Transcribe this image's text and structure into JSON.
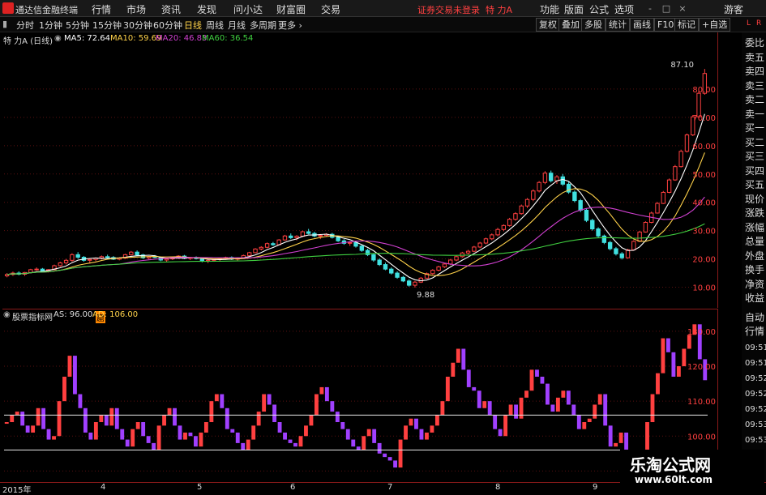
{
  "titlebar": {
    "app_name": "通达信金融终端",
    "menus": [
      "行情",
      "市场",
      "资讯",
      "发现",
      "问小达",
      "财富圈",
      "交易"
    ],
    "trade_notice": "证券交易未登录",
    "stock_name": "特 力A",
    "right_menus": [
      "功能",
      "版面",
      "公式",
      "选项"
    ],
    "guest": "游客",
    "window_buttons": [
      "-",
      "□",
      "×"
    ]
  },
  "toolbar": {
    "periods": [
      "分时",
      "1分钟",
      "5分钟",
      "15分钟",
      "30分钟",
      "60分钟",
      "日线",
      "周线",
      "月线",
      "多周期",
      "更多"
    ],
    "active_period": "日线",
    "buttons": [
      "复权",
      "叠加",
      "多股",
      "统计",
      "画线",
      "F10",
      "标记",
      "+自选"
    ]
  },
  "main_chart": {
    "title": "特 力A (日线)",
    "ma_legend": [
      {
        "label": "MA5: 72.64",
        "color": "#ffffff"
      },
      {
        "label": "MA10: 59.69",
        "color": "#ffd24a"
      },
      {
        "label": "MA20: 46.83",
        "color": "#d040d0"
      },
      {
        "label": "MA60: 36.54",
        "color": "#40d040"
      }
    ],
    "high_label": "87.10",
    "low_label": "9.88",
    "marker": "窟"
  },
  "sub_chart": {
    "title": "股票指标网",
    "as_label": "AS: 96.00",
    "ad_label": "AD: 106.00"
  },
  "right_panel": {
    "labels": [
      "委比",
      "卖五",
      "卖四",
      "卖三",
      "卖二",
      "卖一",
      "买一",
      "买二",
      "买三",
      "买四",
      "买五",
      "现价",
      "涨跌",
      "涨幅",
      "总量",
      "外盘",
      "换手",
      "净资",
      "收益",
      "自动",
      "行情"
    ],
    "times": [
      "09:51",
      "09:51",
      "09:52",
      "09:52",
      "09:52",
      "09:53",
      "09:53"
    ],
    "top_icons": [
      "L",
      "R"
    ]
  },
  "date_axis": [
    "2015年",
    "4",
    "5",
    "6",
    "7",
    "8",
    "9"
  ],
  "watermark": {
    "line1": "乐淘公式网",
    "line2": "www.60lt.com"
  },
  "chart_data": [
    {
      "type": "candlestick",
      "title": "",
      "ylim": [
        5,
        92
      ],
      "y_ticks": [
        10,
        20,
        30,
        40,
        50,
        60,
        70,
        80
      ],
      "annotations": [
        {
          "label": "87.10",
          "value": 87.1
        },
        {
          "label": "9.88",
          "value": 9.88
        }
      ],
      "ohlc": [
        [
          14,
          15,
          13.5,
          14.5
        ],
        [
          14.5,
          15.5,
          14,
          15
        ],
        [
          15,
          15.6,
          14.2,
          14.6
        ],
        [
          14.6,
          15.4,
          14,
          15.2
        ],
        [
          15.2,
          16.5,
          15,
          16.2
        ],
        [
          16.2,
          17,
          15.8,
          16.4
        ],
        [
          16.4,
          16.8,
          15.4,
          15.6
        ],
        [
          15.6,
          16.4,
          15.2,
          16.2
        ],
        [
          16.2,
          18,
          16,
          17.6
        ],
        [
          17.6,
          19,
          17.2,
          18.6
        ],
        [
          18.6,
          20,
          18,
          19.5
        ],
        [
          19.5,
          22,
          19,
          21.5
        ],
        [
          21.5,
          22.4,
          20,
          20.6
        ],
        [
          20.6,
          21,
          19,
          19.5
        ],
        [
          19.5,
          20.2,
          18.4,
          19.8
        ],
        [
          19.8,
          20.5,
          19.2,
          20.3
        ],
        [
          20.3,
          21.2,
          19.8,
          20.8
        ],
        [
          20.8,
          21.5,
          20.2,
          20.5
        ],
        [
          20.5,
          21,
          19.6,
          19.9
        ],
        [
          19.9,
          20.6,
          19.5,
          20.3
        ],
        [
          20.3,
          21.8,
          20,
          21.5
        ],
        [
          21.5,
          22.8,
          21.2,
          22.4
        ],
        [
          22.4,
          23,
          21,
          21.4
        ],
        [
          21.4,
          21.8,
          20,
          20.4
        ],
        [
          20.4,
          21,
          19.8,
          20.8
        ],
        [
          20.8,
          21.4,
          20.2,
          20.5
        ],
        [
          20.5,
          20.8,
          19.2,
          19.6
        ],
        [
          19.6,
          20.3,
          19,
          20
        ],
        [
          20,
          20.8,
          19.6,
          20.5
        ],
        [
          20.5,
          21.3,
          20,
          21
        ],
        [
          21,
          21.4,
          19.9,
          20.2
        ],
        [
          20.2,
          20.7,
          19.6,
          20.5
        ],
        [
          20.5,
          20.9,
          19.8,
          20.1
        ],
        [
          20.1,
          20.4,
          18.8,
          19.2
        ],
        [
          19.2,
          19.8,
          18.5,
          19.5
        ],
        [
          19.5,
          20.1,
          19,
          19.8
        ],
        [
          19.8,
          20.4,
          19.3,
          20.1
        ],
        [
          20.1,
          20.8,
          19.7,
          20.5
        ],
        [
          20.5,
          20.9,
          19.6,
          19.9
        ],
        [
          19.9,
          20.6,
          19.4,
          20.3
        ],
        [
          20.3,
          21.5,
          20,
          21.2
        ],
        [
          21.2,
          22.5,
          21,
          22.2
        ],
        [
          22.2,
          23.8,
          22,
          23.5
        ],
        [
          23.5,
          24.5,
          23,
          24.1
        ],
        [
          24.1,
          25.8,
          23.8,
          25.4
        ],
        [
          25.4,
          26,
          24.6,
          25
        ],
        [
          25,
          27,
          24.8,
          26.7
        ],
        [
          26.7,
          28.5,
          26.4,
          28.1
        ],
        [
          28.1,
          29,
          27,
          27.5
        ],
        [
          27.5,
          28.4,
          26.6,
          28
        ],
        [
          28,
          30,
          27.7,
          29.6
        ],
        [
          29.6,
          30.6,
          28.7,
          29
        ],
        [
          29,
          29.6,
          27.6,
          28.1
        ],
        [
          28.1,
          28.8,
          27,
          28.3
        ],
        [
          28.3,
          29.1,
          27.8,
          28.7
        ],
        [
          28.7,
          29.2,
          27.2,
          27.6
        ],
        [
          27.6,
          28,
          26,
          26.4
        ],
        [
          26.4,
          27,
          25,
          25.5
        ],
        [
          25.5,
          26.2,
          24.6,
          25.8
        ],
        [
          25.8,
          26.4,
          24,
          24.5
        ],
        [
          24.5,
          25,
          22.5,
          23
        ],
        [
          23,
          23.6,
          21,
          21.5
        ],
        [
          21.5,
          22,
          19,
          19.6
        ],
        [
          19.6,
          20.2,
          17.5,
          18
        ],
        [
          18,
          18.7,
          16,
          16.4
        ],
        [
          16.4,
          17,
          14.5,
          15
        ],
        [
          15,
          15.6,
          13,
          13.5
        ],
        [
          13.5,
          14,
          11.8,
          12.2
        ],
        [
          12.2,
          12.8,
          10.2,
          10.7
        ],
        [
          10.7,
          12.2,
          9.88,
          11.8
        ],
        [
          11.8,
          13.6,
          11.5,
          13.2
        ],
        [
          13.2,
          15.2,
          13,
          14.8
        ],
        [
          14.8,
          16.4,
          14.4,
          16
        ],
        [
          16,
          17.6,
          15.6,
          17.2
        ],
        [
          17.2,
          18.6,
          16.8,
          18.2
        ],
        [
          18.2,
          20,
          17.8,
          19.6
        ],
        [
          19.6,
          21.2,
          19.2,
          20.8
        ],
        [
          20.8,
          22.5,
          20.4,
          22.1
        ],
        [
          22.1,
          23.2,
          21.6,
          22.7
        ],
        [
          22.7,
          24.6,
          22.4,
          24.2
        ],
        [
          24.2,
          26,
          23.8,
          25.6
        ],
        [
          25.6,
          27.5,
          25.2,
          27.1
        ],
        [
          27.1,
          29,
          26.6,
          28.5
        ],
        [
          28.5,
          31,
          28,
          30.4
        ],
        [
          30.4,
          32.2,
          29.8,
          31.8
        ],
        [
          31.8,
          34.5,
          31.4,
          34
        ],
        [
          34,
          36.5,
          33.5,
          36
        ],
        [
          36,
          39.2,
          35.6,
          38.7
        ],
        [
          38.7,
          41.5,
          38,
          41
        ],
        [
          41,
          44.6,
          40.4,
          44
        ],
        [
          44,
          47.5,
          43.5,
          47
        ],
        [
          47,
          51,
          46.4,
          50.3
        ],
        [
          50.3,
          51.2,
          47,
          47.6
        ],
        [
          47.6,
          49.6,
          46.5,
          49
        ],
        [
          49,
          50,
          45.8,
          46.4
        ],
        [
          46.4,
          47.2,
          43,
          43.6
        ],
        [
          43.6,
          44.2,
          40,
          40.6
        ],
        [
          40.6,
          41.2,
          36.5,
          37.2
        ],
        [
          37.2,
          37.8,
          33,
          33.6
        ],
        [
          33.6,
          34.2,
          30,
          30.6
        ],
        [
          30.6,
          31.2,
          27.5,
          28.1
        ],
        [
          28.1,
          28.6,
          25.2,
          25.8
        ],
        [
          25.8,
          26.4,
          23,
          23.6
        ],
        [
          23.6,
          24.2,
          21.2,
          21.8
        ],
        [
          21.8,
          22.4,
          19.8,
          20.4
        ],
        [
          20.4,
          23.6,
          20.1,
          23.2
        ],
        [
          23.2,
          26.6,
          23,
          26.2
        ],
        [
          26.2,
          29.9,
          26,
          29.5
        ],
        [
          29.5,
          33.3,
          29.3,
          32.9
        ],
        [
          32.9,
          36.7,
          32.6,
          36.2
        ],
        [
          36.2,
          40.1,
          36,
          39.6
        ],
        [
          39.6,
          44,
          39.4,
          43.5
        ],
        [
          43.5,
          48.4,
          43.2,
          47.9
        ],
        [
          47.9,
          53.2,
          47.6,
          52.6
        ],
        [
          52.6,
          58.6,
          52.3,
          58
        ],
        [
          58,
          64.3,
          57.6,
          63.8
        ],
        [
          63.8,
          70.8,
          63.4,
          70.2
        ],
        [
          70.2,
          79.4,
          69.8,
          78.5
        ],
        [
          78.5,
          87.1,
          78,
          85.5
        ]
      ],
      "series": [
        {
          "name": "MA5",
          "color": "#ffffff"
        },
        {
          "name": "MA10",
          "color": "#ffd24a"
        },
        {
          "name": "MA20",
          "color": "#d040d0"
        },
        {
          "name": "MA60",
          "color": "#40d040"
        }
      ]
    },
    {
      "type": "bar",
      "title": "",
      "ylim": [
        88,
        133
      ],
      "y_ticks": [
        90,
        100,
        110,
        120,
        130
      ],
      "reference_lines": [
        {
          "label": "AS",
          "value": 96
        },
        {
          "label": "AD",
          "value": 106
        }
      ],
      "values": [
        104,
        106,
        107,
        103,
        101,
        103,
        108,
        102,
        99,
        100,
        110,
        117,
        123,
        112,
        108,
        101,
        99,
        104,
        106,
        103,
        108,
        102,
        99,
        97,
        102,
        104,
        100,
        98,
        96,
        103,
        106,
        108,
        103,
        99,
        101,
        100,
        97,
        101,
        104,
        110,
        112,
        108,
        102,
        101,
        98,
        96,
        99,
        103,
        107,
        112,
        109,
        104,
        101,
        99,
        98,
        97,
        100,
        103,
        106,
        112,
        114,
        110,
        107,
        104,
        102,
        99,
        97,
        96,
        100,
        102,
        98,
        95,
        94,
        93,
        91,
        99,
        103,
        105,
        102,
        99,
        101,
        103,
        106,
        110,
        117,
        121,
        125,
        119,
        114,
        113,
        108,
        110,
        106,
        102,
        100,
        106,
        109,
        105,
        111,
        113,
        119,
        117,
        115,
        109,
        107,
        111,
        113,
        109,
        106,
        102,
        104,
        105,
        109,
        112,
        103,
        97,
        98,
        101,
        95,
        96,
        93,
        94,
        104,
        112,
        118,
        128,
        124,
        117,
        120,
        125,
        129,
        132,
        122,
        116
      ],
      "colors_rule": "up=#ff4040, down=#a040ff"
    }
  ]
}
